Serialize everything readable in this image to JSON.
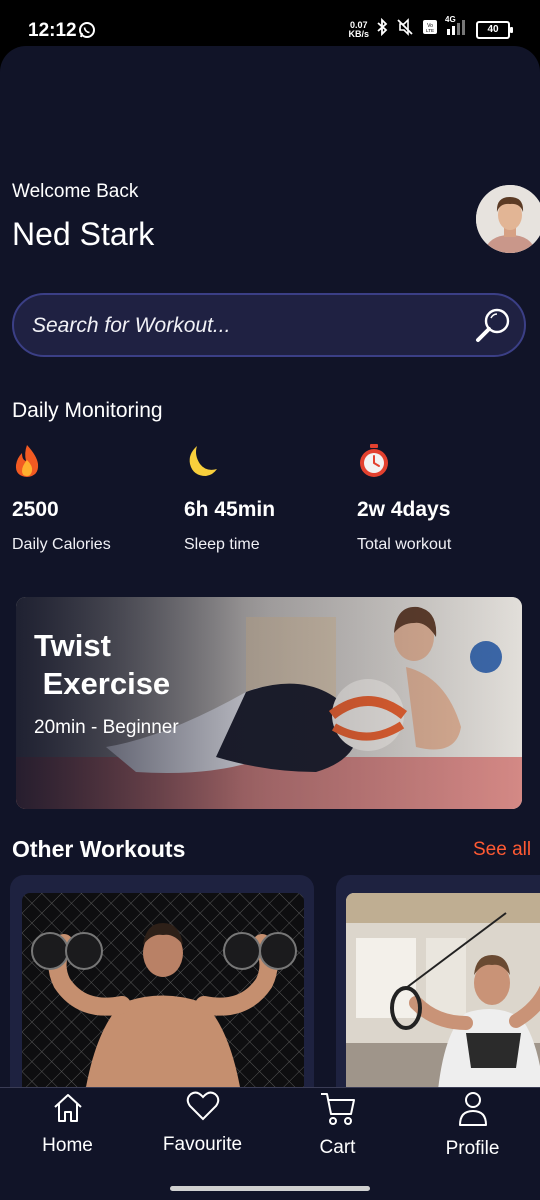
{
  "status_bar": {
    "time": "12:12",
    "net_speed_value": "0.07",
    "net_speed_unit": "KB/s",
    "network": "4G",
    "battery": "40"
  },
  "header": {
    "welcome": "Welcome Back",
    "user_name": "Ned Stark"
  },
  "search": {
    "placeholder": "Search for Workout..."
  },
  "daily_monitoring": {
    "title": "Daily Monitoring",
    "metrics": [
      {
        "icon": "flame-icon",
        "value": "2500",
        "label": "Daily Calories"
      },
      {
        "icon": "moon-icon",
        "value": "6h 45min",
        "label": "Sleep time"
      },
      {
        "icon": "stopwatch-icon",
        "value": "2w 4days",
        "label": "Total workout"
      }
    ]
  },
  "featured": {
    "title": "Twist\n Exercise",
    "subtitle": "20min - Beginner"
  },
  "other_workouts": {
    "title": "Other Workouts",
    "see_all": "See all"
  },
  "bottom_nav": [
    {
      "label": "Home",
      "icon": "home-icon"
    },
    {
      "label": "Favourite",
      "icon": "heart-icon"
    },
    {
      "label": "Cart",
      "icon": "cart-icon"
    },
    {
      "label": "Profile",
      "icon": "user-icon"
    }
  ],
  "colors": {
    "background": "#111428",
    "card": "#1e2240",
    "search_border": "#3b3f86",
    "accent": "#ff5a33"
  }
}
